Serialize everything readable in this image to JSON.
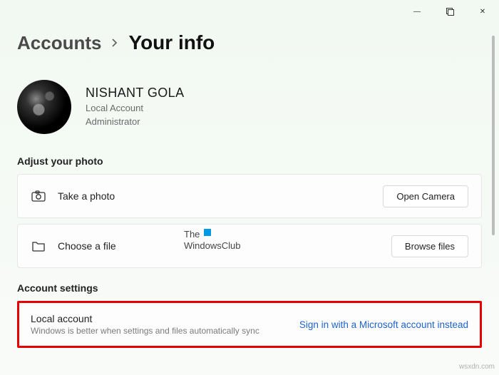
{
  "window": {
    "minimize": "—",
    "maximize": "□",
    "close": "✕"
  },
  "breadcrumb": {
    "parent": "Accounts",
    "current": "Your info"
  },
  "profile": {
    "name": "NISHANT GOLA",
    "type": "Local Account",
    "role": "Administrator"
  },
  "photo_section": {
    "heading": "Adjust your photo",
    "take_photo_label": "Take a photo",
    "open_camera_label": "Open Camera",
    "choose_file_label": "Choose a file",
    "browse_files_label": "Browse files"
  },
  "watermark": {
    "line1": "The",
    "line2": "WindowsClub"
  },
  "account_settings": {
    "heading": "Account settings",
    "title": "Local account",
    "description": "Windows is better when settings and files automatically sync",
    "link": "Sign in with a Microsoft account instead"
  },
  "attribution": "wsxdn.com"
}
